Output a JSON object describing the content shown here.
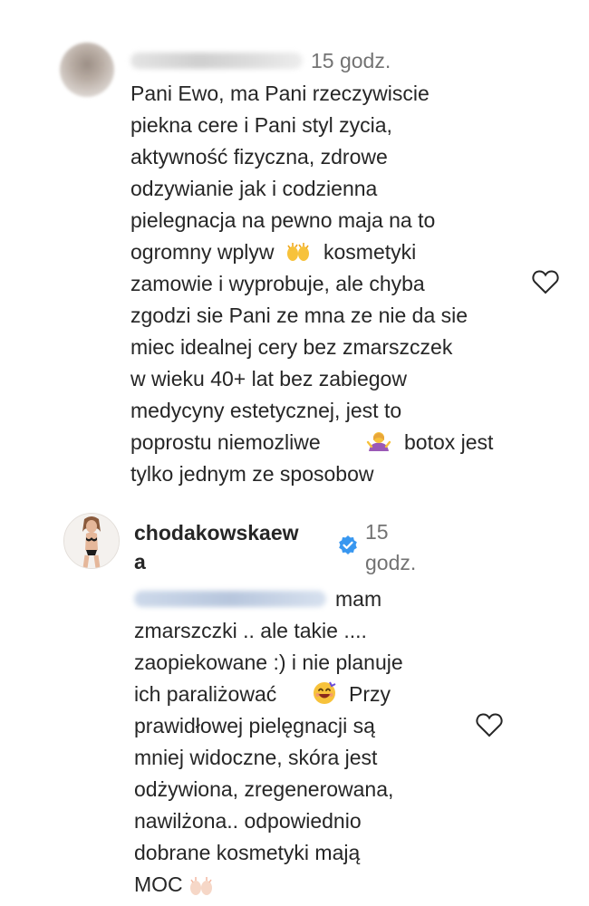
{
  "comment1": {
    "time": "15 godz.",
    "lines": [
      "Pani Ewo, ma Pani rzeczywiscie",
      "piekna cere i Pani styl zycia,",
      "aktywność fizyczna, zdrowe",
      "odzywianie jak i codzienna",
      "pielegnacja na pewno maja na to",
      "ogromny wplyw",
      "kosmetyki",
      "zamowie i wyprobuje, ale chyba",
      "zgodzi sie Pani ze mna ze nie da sie",
      "miec idealnej cery bez zmarszczek",
      "w wieku 40+ lat bez zabiegow",
      "medycyny estetycznej, jest to",
      "poprostu niemozliwe",
      "botox jest",
      "tylko jednym ze sposobow"
    ],
    "icons": [
      "raising-hands-icon",
      "shrugging-woman-icon",
      "heart-icon"
    ]
  },
  "comment2": {
    "username_line1": "chodakowskaew",
    "username_line2": "a",
    "time_line1": "15",
    "time_line2": "godz.",
    "lines": [
      "mam",
      "zmarszczki .. ale takie ....",
      "zaopiekowane :) i nie planuje",
      "ich paraliżować",
      "Przy",
      "prawidłowej pielęgnacji są",
      "mniej widoczne, skóra jest",
      "odżywiona, zregenerowana,",
      "nawilżona.. odpowiednio",
      "dobrane kosmetyki mają",
      "MOC"
    ],
    "icons": [
      "smiling-face-icon",
      "raised-hands-icon",
      "verified-badge-icon",
      "heart-icon"
    ],
    "verified_color": "#3897f0"
  }
}
